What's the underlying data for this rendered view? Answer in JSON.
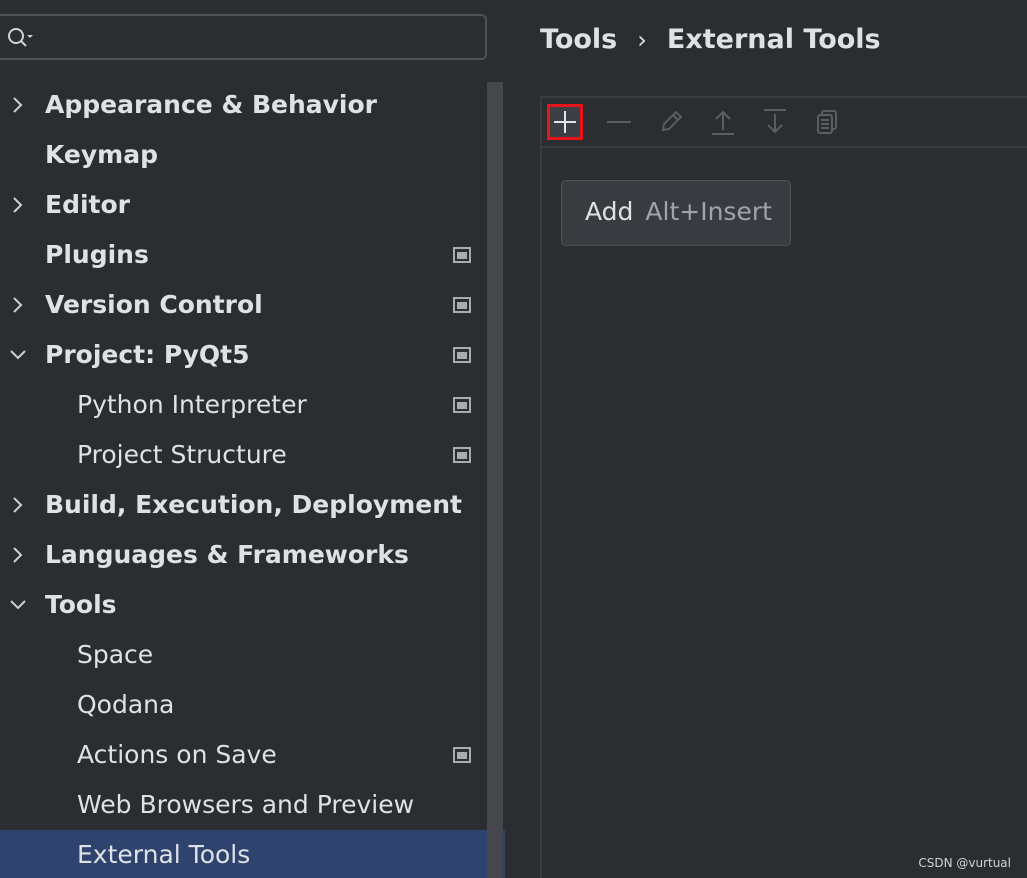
{
  "sidebar": {
    "items": [
      {
        "label": "Appearance & Behavior",
        "level": 0,
        "chevron": "right",
        "bold": true,
        "project_icon": false
      },
      {
        "label": "Keymap",
        "level": 0,
        "chevron": "none",
        "bold": true,
        "project_icon": false
      },
      {
        "label": "Editor",
        "level": 0,
        "chevron": "right",
        "bold": true,
        "project_icon": false
      },
      {
        "label": "Plugins",
        "level": 0,
        "chevron": "none",
        "bold": true,
        "project_icon": true
      },
      {
        "label": "Version Control",
        "level": 0,
        "chevron": "right",
        "bold": true,
        "project_icon": true
      },
      {
        "label": "Project: PyQt5",
        "level": 0,
        "chevron": "down",
        "bold": true,
        "project_icon": true
      },
      {
        "label": "Python Interpreter",
        "level": 1,
        "chevron": "none",
        "bold": false,
        "project_icon": true
      },
      {
        "label": "Project Structure",
        "level": 1,
        "chevron": "none",
        "bold": false,
        "project_icon": true
      },
      {
        "label": "Build, Execution, Deployment",
        "level": 0,
        "chevron": "right",
        "bold": true,
        "project_icon": false
      },
      {
        "label": "Languages & Frameworks",
        "level": 0,
        "chevron": "right",
        "bold": true,
        "project_icon": false
      },
      {
        "label": "Tools",
        "level": 0,
        "chevron": "down",
        "bold": true,
        "project_icon": false
      },
      {
        "label": "Space",
        "level": 1,
        "chevron": "none",
        "bold": false,
        "project_icon": false
      },
      {
        "label": "Qodana",
        "level": 1,
        "chevron": "none",
        "bold": false,
        "project_icon": false
      },
      {
        "label": "Actions on Save",
        "level": 1,
        "chevron": "none",
        "bold": false,
        "project_icon": true
      },
      {
        "label": "Web Browsers and Preview",
        "level": 1,
        "chevron": "none",
        "bold": false,
        "project_icon": false
      },
      {
        "label": "External Tools",
        "level": 1,
        "chevron": "none",
        "bold": false,
        "project_icon": false,
        "selected": true
      }
    ]
  },
  "breadcrumb": {
    "parent": "Tools",
    "separator": "›",
    "current": "External Tools"
  },
  "toolbar": {
    "buttons": [
      "plus-icon",
      "minus-icon",
      "pencil-icon",
      "move-up-icon",
      "move-down-icon",
      "copy-icon"
    ]
  },
  "tooltip": {
    "label": "Add",
    "shortcut": "Alt+Insert"
  },
  "watermark": "CSDN @vurtual",
  "colors": {
    "background": "#2b2d30",
    "selection": "#2e436e",
    "highlight_border": "#e8141c",
    "text": "#dfe1e5"
  }
}
